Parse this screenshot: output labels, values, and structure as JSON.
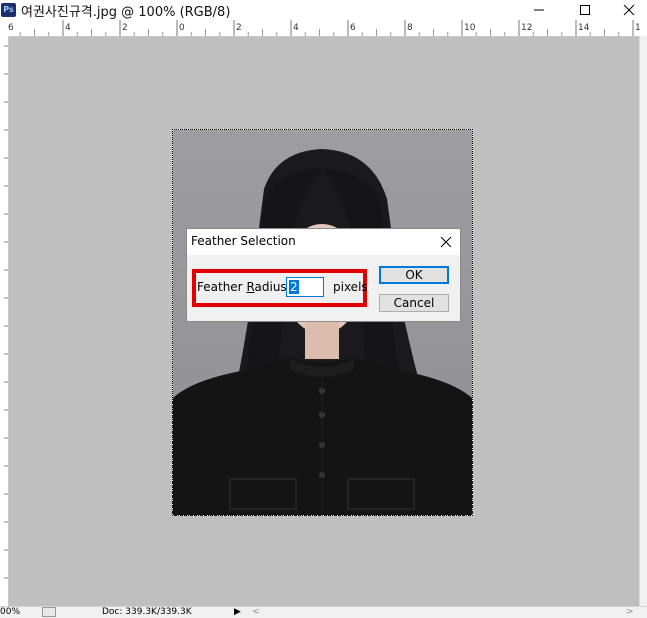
{
  "window": {
    "title": "여권사진규격.jpg @ 100% (RGB/8)",
    "app_icon_text": "Ps",
    "minimize_icon": "minimize-icon",
    "maximize_icon": "maximize-icon",
    "close_icon": "close-icon"
  },
  "ruler": {
    "top_ticks": [
      "6",
      "4",
      "2",
      "0",
      "2",
      "4",
      "6",
      "8",
      "10",
      "12",
      "14",
      "16"
    ]
  },
  "dialog": {
    "title": "Feather Selection",
    "label_pre": "Feather ",
    "label_underlined": "R",
    "label_post": "adius:",
    "radius_value": "2",
    "units": "pixels",
    "ok_label": "OK",
    "cancel_label": "Cancel",
    "highlight_color": "#e00000"
  },
  "status": {
    "zoom": "00%",
    "doc": "Doc: 339.3K/339.3K"
  },
  "colors": {
    "canvas_bg": "#bfbfbf",
    "accent": "#0078d7"
  }
}
